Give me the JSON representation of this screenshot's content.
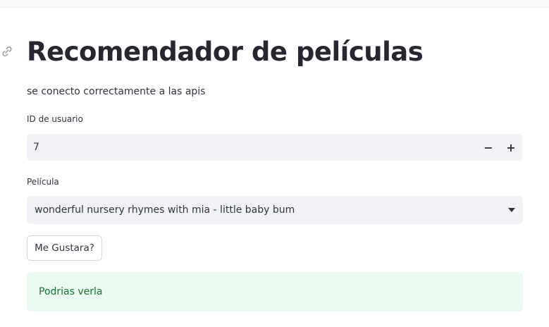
{
  "header": {
    "title": "Recomendador de películas",
    "anchor_icon": "link-icon"
  },
  "status": {
    "message": "se conecto correctamente a las apis"
  },
  "user_id": {
    "label": "ID de usuario",
    "value": "7",
    "decrement_label": "−",
    "increment_label": "+"
  },
  "movie": {
    "label": "Película",
    "selected": "wonderful nursery rhymes with mia - little baby bum",
    "dropdown_icon": "caret-down-icon"
  },
  "action": {
    "button_label": "Me Gustara?"
  },
  "result": {
    "message": "Podrias verla",
    "color": "#177233",
    "background": "#ebfaf1"
  }
}
